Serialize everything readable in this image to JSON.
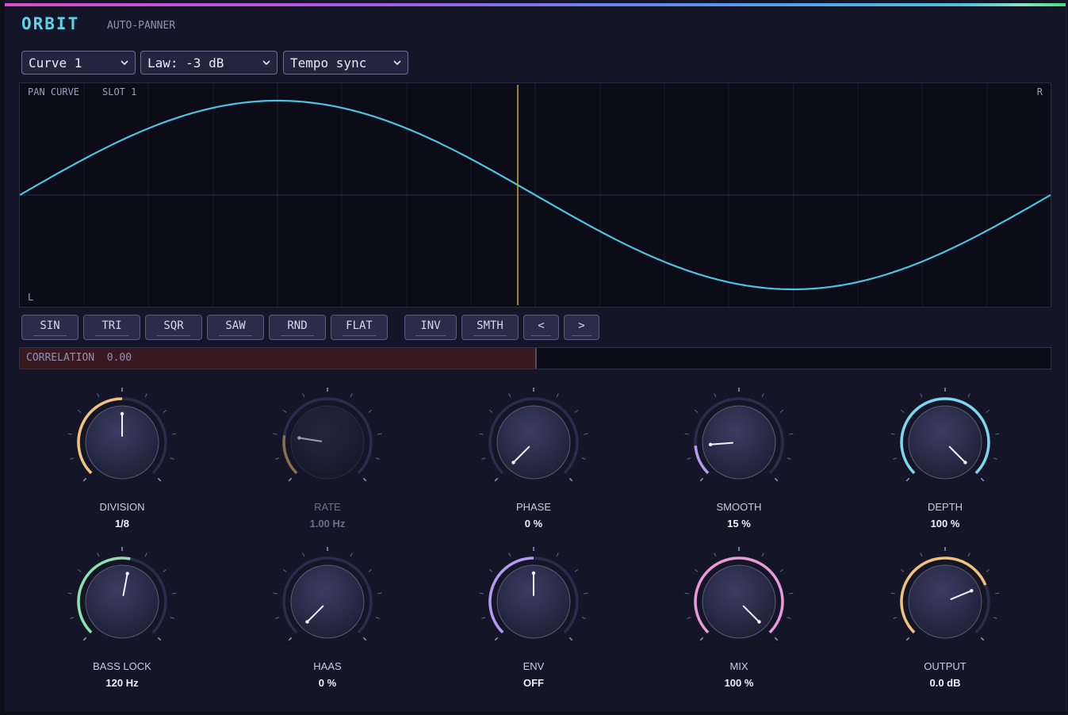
{
  "app": {
    "title": "ORBIT",
    "subtitle": "AUTO-PANNER"
  },
  "dropdowns": [
    {
      "label": "Curve 1"
    },
    {
      "label": "Law: -3 dB"
    },
    {
      "label": "Tempo sync"
    }
  ],
  "curve": {
    "caption": "PAN CURVE",
    "slot": "SLOT 1",
    "right_label": "R",
    "left_label": "L",
    "color": "#4ec3e0",
    "playhead_color": "#c8a838"
  },
  "shape_buttons": [
    "SIN",
    "TRI",
    "SQR",
    "SAW",
    "RND",
    "FLAT"
  ],
  "edit_buttons": [
    "INV",
    "SMTH",
    "<",
    ">"
  ],
  "correlation": {
    "label": "CORRELATION",
    "value": "0.00"
  },
  "knobs": [
    {
      "name": "DIVISION",
      "value": "1/8",
      "color": "#f2c27a",
      "level": 0.5,
      "dimmed": false
    },
    {
      "name": "RATE",
      "value": "1.00 Hz",
      "color": "#8a6f4a",
      "level": 0.2,
      "dimmed": true
    },
    {
      "name": "PHASE",
      "value": "0 %",
      "color": "#f2c27a",
      "level": 0.0,
      "dimmed": false
    },
    {
      "name": "SMOOTH",
      "value": "15 %",
      "color": "#b59af0",
      "level": 0.15,
      "dimmed": false
    },
    {
      "name": "DEPTH",
      "value": "100 %",
      "color": "#7fd6f0",
      "level": 1.0,
      "dimmed": false
    },
    {
      "name": "BASS LOCK",
      "value": "120 Hz",
      "color": "#8fe0b0",
      "level": 0.54,
      "dimmed": false
    },
    {
      "name": "HAAS",
      "value": "0 %",
      "color": "#7fd6f0",
      "level": 0.0,
      "dimmed": false
    },
    {
      "name": "ENV",
      "value": "OFF",
      "color": "#b59af0",
      "level": 0.5,
      "dimmed": false
    },
    {
      "name": "MIX",
      "value": "100 %",
      "color": "#e79ad6",
      "level": 1.0,
      "dimmed": false
    },
    {
      "name": "OUTPUT",
      "value": "0.0 dB",
      "color": "#f2c27a",
      "level": 0.75,
      "dimmed": false
    }
  ]
}
